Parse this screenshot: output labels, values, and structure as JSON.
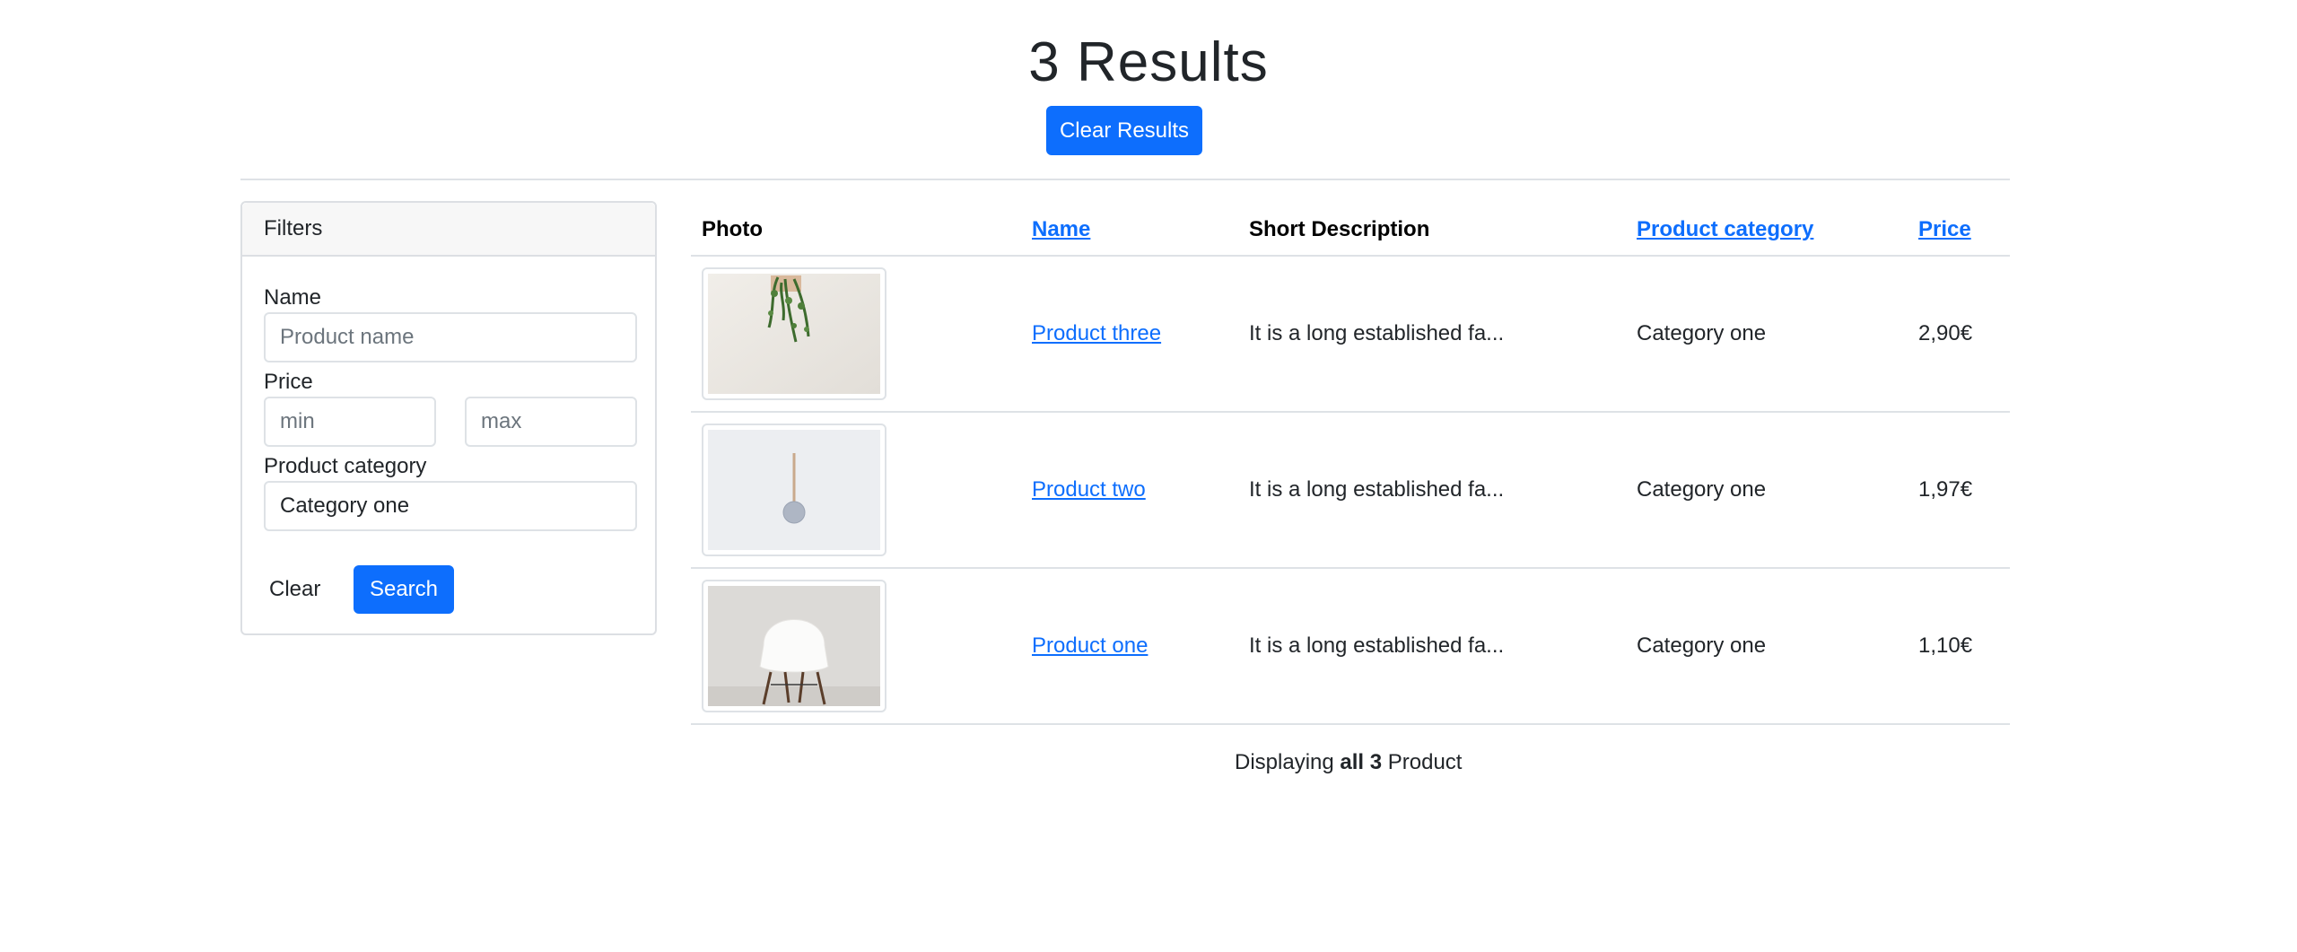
{
  "header": {
    "title": "3 Results",
    "clear_results_label": "Clear Results"
  },
  "filters": {
    "title": "Filters",
    "name_label": "Name",
    "name_placeholder": "Product name",
    "price_label": "Price",
    "min_placeholder": "min",
    "max_placeholder": "max",
    "category_label": "Product category",
    "category_selected": "Category one",
    "clear_label": "Clear",
    "search_label": "Search"
  },
  "table": {
    "columns": [
      "Photo",
      "Name",
      "Short Description",
      "Product category",
      "Price"
    ],
    "rows": [
      {
        "name": "Product three",
        "description": "It is a long established fa...",
        "category": "Category one",
        "price": "2,90€",
        "image": "hanging-plant-image"
      },
      {
        "name": "Product two",
        "description": "It is a long established fa...",
        "category": "Category one",
        "price": "1,97€",
        "image": "wall-clock-image"
      },
      {
        "name": "Product one",
        "description": "It is a long established fa...",
        "category": "Category one",
        "price": "1,10€",
        "image": "white-chair-image"
      }
    ]
  },
  "footer": {
    "prefix": "Displaying",
    "bold": "all 3",
    "suffix": "Product"
  },
  "colors": {
    "primary": "#0d6efd",
    "border": "#dee2e6",
    "text": "#212529"
  }
}
